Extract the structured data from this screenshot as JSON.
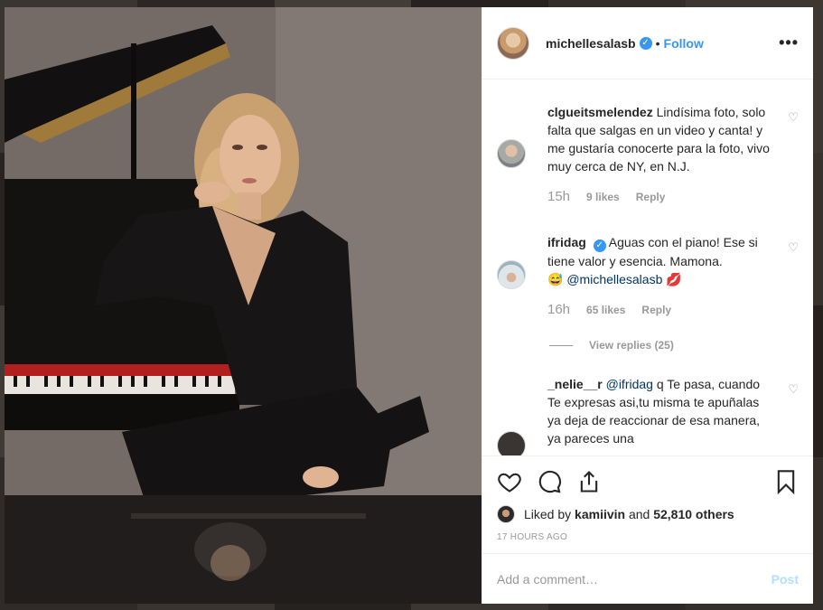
{
  "post": {
    "username": "michellesalasb",
    "verified_icon": "verified-badge-icon",
    "separator": "•",
    "follow_label": "Follow",
    "more_label": "•••"
  },
  "comments": [
    {
      "username": "clgueitsmelendez",
      "text": "Lindísima foto, solo falta que salgas en un video y canta! y me gustaría conocerte para la foto, vivo muy cerca de NY, en N.J.",
      "time": "15h",
      "likes": "9 likes",
      "reply": "Reply"
    },
    {
      "username": "ifridag",
      "text": "Aguas con el piano! Ese si tiene valor y esencia. Mamona.",
      "emoji1": "😅",
      "mention": "@michellesalasb",
      "emoji2": "💋",
      "time": "16h",
      "likes": "65 likes",
      "reply": "Reply",
      "view_replies": "View replies (25)"
    },
    {
      "username": "_nelie__r",
      "mention": "@ifridag",
      "text": "q Te pasa, cuando Te expresas asi,tu misma te apuñalas ya deja de reaccionar de esa manera, ya pareces una"
    }
  ],
  "actions": {
    "liked_by_prefix": "Liked by",
    "liked_by_user": "kamiivin",
    "liked_by_mid": "and",
    "liked_by_count": "52,810 others",
    "time_ago": "17 HOURS AGO"
  },
  "composer": {
    "placeholder": "Add a comment…",
    "post_label": "Post"
  },
  "colors": {
    "accent": "#3897f0",
    "post_disabled": "#b2dffc",
    "muted": "#999999"
  }
}
